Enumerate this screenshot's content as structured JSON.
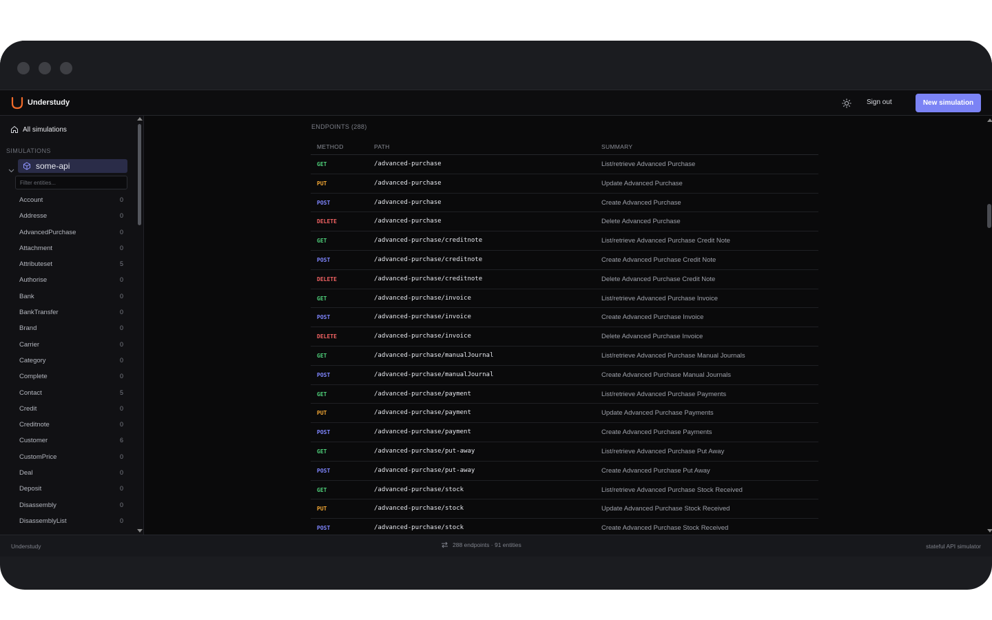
{
  "header": {
    "brand": "Understudy",
    "theme_icon": "sun-icon",
    "signout_label": "Sign out",
    "new_sim_label": "New simulation",
    "accent": "#7b83f5"
  },
  "sidebar": {
    "all_label": "All simulations",
    "section_label": "SIMULATIONS",
    "sim_name": "some-api",
    "filter_placeholder": "Filter entities...",
    "entities": [
      {
        "name": "Account",
        "count": "0"
      },
      {
        "name": "Addresse",
        "count": "0"
      },
      {
        "name": "AdvancedPurchase",
        "count": "0"
      },
      {
        "name": "Attachment",
        "count": "0"
      },
      {
        "name": "Attributeset",
        "count": "5"
      },
      {
        "name": "Authorise",
        "count": "0"
      },
      {
        "name": "Bank",
        "count": "0"
      },
      {
        "name": "BankTransfer",
        "count": "0"
      },
      {
        "name": "Brand",
        "count": "0"
      },
      {
        "name": "Carrier",
        "count": "0"
      },
      {
        "name": "Category",
        "count": "0"
      },
      {
        "name": "Complete",
        "count": "0"
      },
      {
        "name": "Contact",
        "count": "5"
      },
      {
        "name": "Credit",
        "count": "0"
      },
      {
        "name": "Creditnote",
        "count": "0"
      },
      {
        "name": "Customer",
        "count": "6"
      },
      {
        "name": "CustomPrice",
        "count": "0"
      },
      {
        "name": "Deal",
        "count": "0"
      },
      {
        "name": "Deposit",
        "count": "0"
      },
      {
        "name": "Disassembly",
        "count": "0"
      },
      {
        "name": "DisassemblyList",
        "count": "0"
      }
    ]
  },
  "main": {
    "endpoints_label": "ENDPOINTS (288)",
    "columns": {
      "method": "METHOD",
      "path": "PATH",
      "summary": "SUMMARY"
    },
    "method_colors": {
      "GET": "#4fd07a",
      "PUT": "#f0a533",
      "POST": "#7f86ff",
      "DELETE": "#f06262"
    },
    "rows": [
      {
        "method": "GET",
        "path": "/advanced-purchase",
        "summary": "List/retrieve Advanced Purchase"
      },
      {
        "method": "PUT",
        "path": "/advanced-purchase",
        "summary": "Update Advanced Purchase"
      },
      {
        "method": "POST",
        "path": "/advanced-purchase",
        "summary": "Create Advanced Purchase"
      },
      {
        "method": "DELETE",
        "path": "/advanced-purchase",
        "summary": "Delete Advanced Purchase"
      },
      {
        "method": "GET",
        "path": "/advanced-purchase/creditnote",
        "summary": "List/retrieve Advanced Purchase Credit Note"
      },
      {
        "method": "POST",
        "path": "/advanced-purchase/creditnote",
        "summary": "Create Advanced Purchase Credit Note"
      },
      {
        "method": "DELETE",
        "path": "/advanced-purchase/creditnote",
        "summary": "Delete Advanced Purchase Credit Note"
      },
      {
        "method": "GET",
        "path": "/advanced-purchase/invoice",
        "summary": "List/retrieve Advanced Purchase Invoice"
      },
      {
        "method": "POST",
        "path": "/advanced-purchase/invoice",
        "summary": "Create Advanced Purchase Invoice"
      },
      {
        "method": "DELETE",
        "path": "/advanced-purchase/invoice",
        "summary": "Delete Advanced Purchase Invoice"
      },
      {
        "method": "GET",
        "path": "/advanced-purchase/manualJournal",
        "summary": "List/retrieve Advanced Purchase Manual Journals"
      },
      {
        "method": "POST",
        "path": "/advanced-purchase/manualJournal",
        "summary": "Create Advanced Purchase Manual Journals"
      },
      {
        "method": "GET",
        "path": "/advanced-purchase/payment",
        "summary": "List/retrieve Advanced Purchase Payments"
      },
      {
        "method": "PUT",
        "path": "/advanced-purchase/payment",
        "summary": "Update Advanced Purchase Payments"
      },
      {
        "method": "POST",
        "path": "/advanced-purchase/payment",
        "summary": "Create Advanced Purchase Payments"
      },
      {
        "method": "GET",
        "path": "/advanced-purchase/put-away",
        "summary": "List/retrieve Advanced Purchase Put Away"
      },
      {
        "method": "POST",
        "path": "/advanced-purchase/put-away",
        "summary": "Create Advanced Purchase Put Away"
      },
      {
        "method": "GET",
        "path": "/advanced-purchase/stock",
        "summary": "List/retrieve Advanced Purchase Stock Received"
      },
      {
        "method": "PUT",
        "path": "/advanced-purchase/stock",
        "summary": "Update Advanced Purchase Stock Received"
      },
      {
        "method": "POST",
        "path": "/advanced-purchase/stock",
        "summary": "Create Advanced Purchase Stock Received"
      }
    ]
  },
  "footer": {
    "left": "Understudy",
    "middle": "288 endpoints · 91 entities",
    "right": "stateful API simulator"
  }
}
